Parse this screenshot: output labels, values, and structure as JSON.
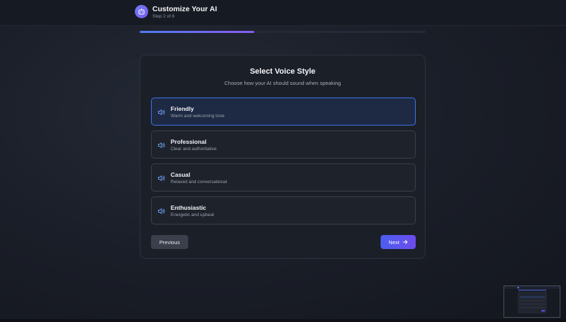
{
  "header": {
    "title": "Customize Your AI",
    "step": "Step 2 of 6",
    "icon": "robot-icon"
  },
  "progress": {
    "current_step": 2,
    "total_steps": 6,
    "fraction": 0.4
  },
  "card": {
    "title": "Select Voice Style",
    "subtitle": "Choose how your AI should sound when speaking"
  },
  "options": [
    {
      "label": "Friendly",
      "description": "Warm and welcoming tone",
      "selected": true,
      "icon": "speaker-icon"
    },
    {
      "label": "Professional",
      "description": "Clear and authoritative",
      "selected": false,
      "icon": "speaker-icon"
    },
    {
      "label": "Casual",
      "description": "Relaxed and conversational",
      "selected": false,
      "icon": "speaker-icon"
    },
    {
      "label": "Enthusiastic",
      "description": "Energetic and upbeat",
      "selected": false,
      "icon": "speaker-icon"
    }
  ],
  "actions": {
    "previous_label": "Previous",
    "next_label": "Next"
  },
  "colors": {
    "accent": "#3d74e8",
    "accent_purple": "#6d4cec",
    "background": "#1b1f28"
  }
}
